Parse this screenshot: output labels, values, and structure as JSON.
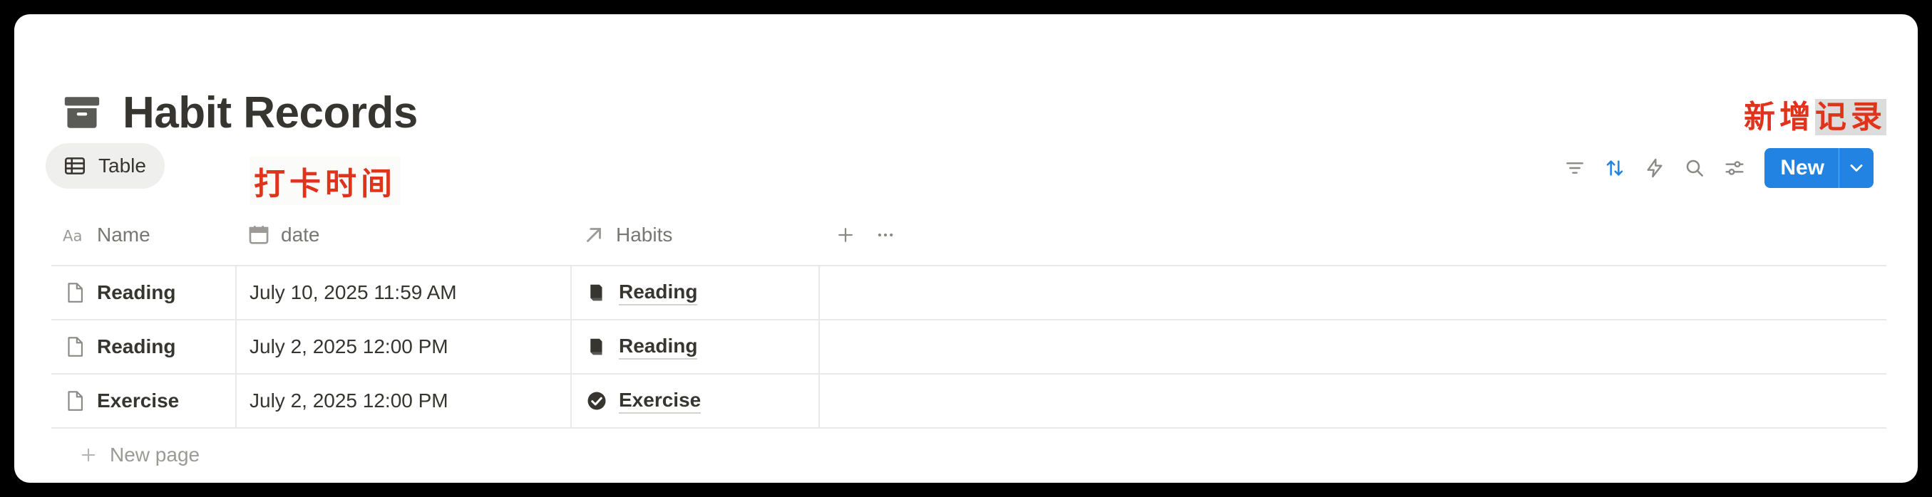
{
  "page": {
    "title": "Habit Records",
    "title_icon": "archive-box-icon"
  },
  "annotations": {
    "checkin_time": "打卡时间",
    "new_record_prefix": "新增",
    "new_record_suffix": "记录",
    "color": "#e0331b"
  },
  "view_tab": {
    "label": "Table",
    "icon": "table-icon"
  },
  "toolbar": {
    "icons": [
      "filter-icon",
      "sort-icon",
      "automation-bolt-icon",
      "search-icon",
      "settings-sliders-icon"
    ],
    "new_label": "New",
    "accent": "#2383e2"
  },
  "table": {
    "columns": [
      {
        "label": "Name",
        "icon": "text-type-icon"
      },
      {
        "label": "date",
        "icon": "calendar-icon"
      },
      {
        "label": "Habits",
        "icon": "relation-arrow-icon"
      }
    ],
    "rows": [
      {
        "name": "Reading",
        "date": "July 10, 2025 11:59 AM",
        "habit": "Reading",
        "habit_icon": "book-icon"
      },
      {
        "name": "Reading",
        "date": "July 2, 2025 12:00 PM",
        "habit": "Reading",
        "habit_icon": "book-icon"
      },
      {
        "name": "Exercise",
        "date": "July 2, 2025 12:00 PM",
        "habit": "Exercise",
        "habit_icon": "check-circle-icon"
      }
    ],
    "new_page_label": "New page"
  }
}
